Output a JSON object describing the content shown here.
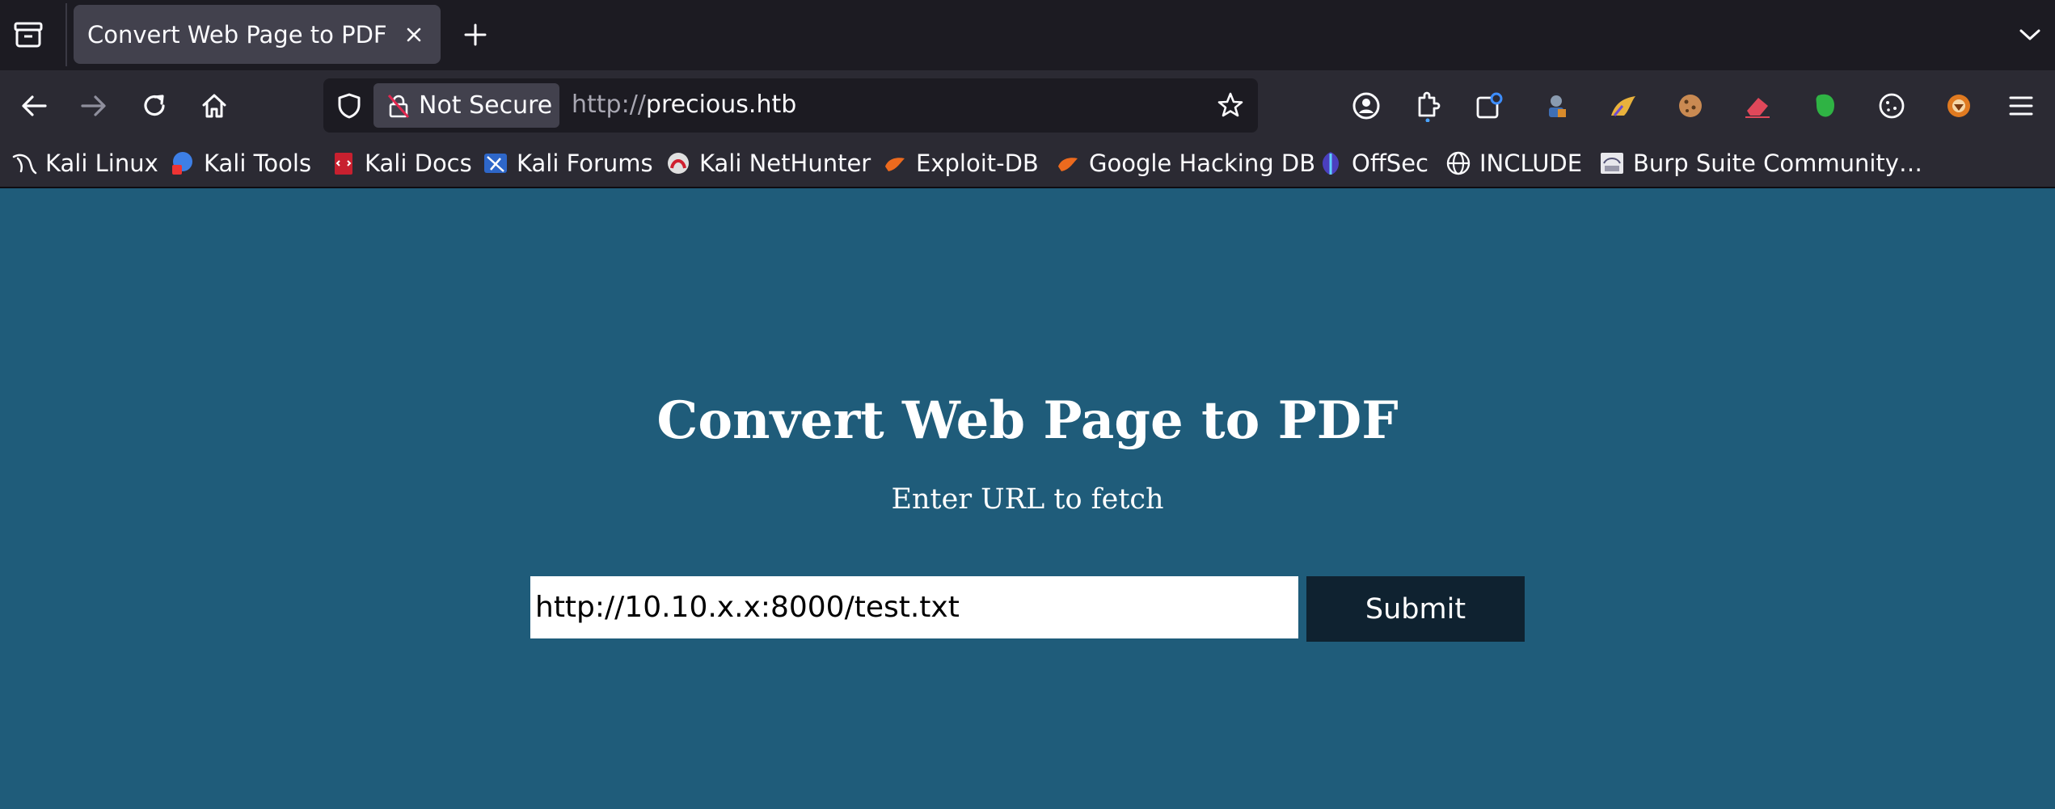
{
  "browser": {
    "tab": {
      "title": "Convert Web Page to PDF"
    },
    "urlbar": {
      "security_label": "Not Secure",
      "url_scheme": "http://",
      "url_host": "precious.htb"
    },
    "bookmarks": [
      {
        "label": "Kali Linux",
        "icon": "kali-dragon-icon"
      },
      {
        "label": "Kali Tools",
        "icon": "kali-tools-icon"
      },
      {
        "label": "Kali Docs",
        "icon": "kali-docs-icon"
      },
      {
        "label": "Kali Forums",
        "icon": "kali-forums-icon"
      },
      {
        "label": "Kali NetHunter",
        "icon": "nethunter-icon"
      },
      {
        "label": "Exploit-DB",
        "icon": "exploit-db-icon"
      },
      {
        "label": "Google Hacking DB",
        "icon": "ghdb-icon"
      },
      {
        "label": "OffSec",
        "icon": "offsec-icon"
      },
      {
        "label": "INCLUDE",
        "icon": "globe-icon"
      },
      {
        "label": "Burp Suite Community…",
        "icon": "burp-icon"
      }
    ]
  },
  "page": {
    "title": "Convert Web Page to PDF",
    "subtitle": "Enter URL to fetch",
    "url_input_value": "http://10.10.x.x:8000/test.txt",
    "submit_label": "Submit"
  },
  "colors": {
    "page_background": "#1f5c7a",
    "button_background": "#0f2230",
    "chrome_dark": "#1c1b22",
    "chrome_toolbar": "#2b2a33"
  }
}
